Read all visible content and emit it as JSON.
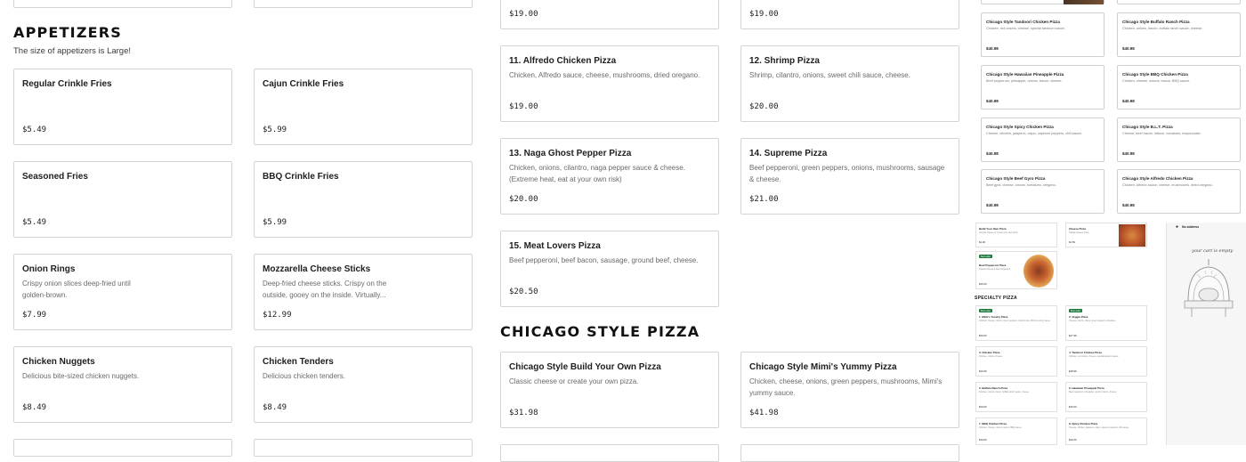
{
  "left": {
    "top_prices": [],
    "section_title": "APPETIZERS",
    "section_subtitle": "The size of appetizers is Large!",
    "items": [
      {
        "name": "Regular Crinkle Fries",
        "desc": "",
        "price": "$5.49"
      },
      {
        "name": "Cajun Crinkle Fries",
        "desc": "",
        "price": "$5.99"
      },
      {
        "name": "Seasoned Fries",
        "desc": "",
        "price": "$5.49"
      },
      {
        "name": "BBQ Crinkle Fries",
        "desc": "",
        "price": "$5.99"
      },
      {
        "name": "Onion Rings",
        "desc": "Crispy onion slices deep-fried until golden-brown.",
        "price": "$7.99"
      },
      {
        "name": "Mozzarella Cheese Sticks",
        "desc": "Deep-fried cheese sticks. Crispy on the outside, gooey on the inside. Virtually...",
        "price": "$12.99"
      },
      {
        "name": "Chicken Nuggets",
        "desc": "Delicious bite-sized chicken nuggets.",
        "price": "$8.49"
      },
      {
        "name": "Chicken Tenders",
        "desc": "Delicious chicken tenders.",
        "price": "$8.49"
      }
    ]
  },
  "middle": {
    "top_prices": [
      "$19.00",
      "$19.00"
    ],
    "pizzas": [
      {
        "name": "11. Alfredo Chicken Pizza",
        "desc": "Chicken, Alfredo sauce, cheese, mushrooms, dried oregano.",
        "price": "$19.00"
      },
      {
        "name": "12. Shrimp Pizza",
        "desc": "Shrimp, cilantro, onions, sweet chili sauce, cheese.",
        "price": "$20.00"
      },
      {
        "name": "13. Naga Ghost Pepper Pizza",
        "desc": "Chicken, onions, cilantro, naga pepper sauce & cheese. (Extreme heat, eat at your own risk)",
        "price": "$20.00"
      },
      {
        "name": "14. Supreme Pizza",
        "desc": "Beef pepperoni, green peppers, onions, mushrooms, sausage & cheese.",
        "price": "$21.00"
      },
      {
        "name": "15. Meat Lovers Pizza",
        "desc": "Beef pepperoni, beef bacon, sausage, ground beef, cheese.",
        "price": "$20.50"
      }
    ],
    "section_title": "CHICAGO STYLE PIZZA",
    "chicago": [
      {
        "name": "Chicago Style Build Your Own Pizza",
        "desc": "Classic cheese or create your own pizza.",
        "price": "$31.98"
      },
      {
        "name": "Chicago Style Mimi's Yummy Pizza",
        "desc": "Chicken, cheese, onions, green peppers, mushrooms, Mimi's yummy sauce.",
        "price": "$41.98"
      }
    ]
  },
  "preview": {
    "cards": [
      {
        "name": "Chicago Style Tandoori Chicken Pizza",
        "desc": "Chicken, red onions, cheese, special tandoori sauce.",
        "price": "$40.98"
      },
      {
        "name": "Chicago Style Buffalo Ranch Pizza",
        "desc": "Chicken, onions, bacon, buffalo ranch sauce, cheese.",
        "price": "$40.98"
      },
      {
        "name": "Chicago Style Hawaiian Pineapple Pizza",
        "desc": "Beef pepperoni, pineapple, onions, bacon, cheese.",
        "price": "$40.98"
      },
      {
        "name": "Chicago Style BBQ Chicken Pizza",
        "desc": "Chicken, cheese, onions, bacon, BBQ sauce.",
        "price": "$40.98"
      },
      {
        "name": "Chicago Style Spicy Chicken Pizza",
        "desc": "Cheese, chicken, jalapeno, cajun, cayenne peppers, chili sauce.",
        "price": "$40.98"
      },
      {
        "name": "Chicago Style B.L.T. Pizza",
        "desc": "Cheese, beef bacon, lettuce, tomatoes, mayonnaise.",
        "price": "$40.98"
      },
      {
        "name": "Chicago Style Beef Gyro Pizza",
        "desc": "Beef gyro, cheese, onions, tomatoes, oregano.",
        "price": "$40.98"
      },
      {
        "name": "Chicago Style Alfredo Chicken Pizza",
        "desc": "Chicken, Alfredo sauce, cheese, mushrooms, dried oregano.",
        "price": "$40.98"
      }
    ]
  },
  "thumbnail": {
    "section_title": "SPECIALTY PIZZA",
    "address_label": "No address",
    "cart_text": "your cart is empty",
    "badge": "Best seller",
    "top_items": [
      {
        "name": "Build Your Own Pizza",
        "desc": "Choose cheese or create your own pizza.",
        "price": "$1.00"
      },
      {
        "name": "Cheese Pizza",
        "desc": "Classic cheese pizza.",
        "price": "$1.50"
      },
      {
        "name": "Beef Pepperoni Pizza",
        "desc": "Classic cheese & beef pepperoni.",
        "price": "$16.00"
      }
    ],
    "items": [
      {
        "name": "1. Mimi's Yummy Pizza",
        "desc": "Chicken, cheese, onions, green peppers, mushrooms, Mimi's yummy sauce.",
        "price": "$20.00"
      },
      {
        "name": "2. Veggie Pizza",
        "desc": "Cheese, onions, olives, green peppers, tomatoes.",
        "price": "$17.99"
      },
      {
        "name": "3. Chicken Pizza",
        "desc": "Chicken, onions, cheese.",
        "price": "$16.99"
      },
      {
        "name": "4. Tandoori Chicken Pizza",
        "desc": "Chicken, red onions, cheese, special tandoori sauce.",
        "price": "$18.99"
      },
      {
        "name": "5. Buffalo Ranch Pizza",
        "desc": "Chicken, onions, bacon, buffalo ranch sauce, cheese.",
        "price": "$19.00"
      },
      {
        "name": "6. Hawaiian Pineapple Pizza",
        "desc": "Beef pepperoni, pineapple, onions, bacon, cheese.",
        "price": "$19.00"
      },
      {
        "name": "7. BBQ Chicken Pizza",
        "desc": "Chicken, cheese, onions, bacon, BBQ sauce.",
        "price": "$19.00"
      },
      {
        "name": "8. Spicy Chicken Pizza",
        "desc": "Cheese, chicken, jalapeno, cajun, cayenne peppers, chili sauce.",
        "price": "$19.00"
      }
    ]
  },
  "colors": {
    "accent_green": "#1f7a3e",
    "border": "#d4d4d4",
    "muted_text": "#6a6a6a"
  }
}
